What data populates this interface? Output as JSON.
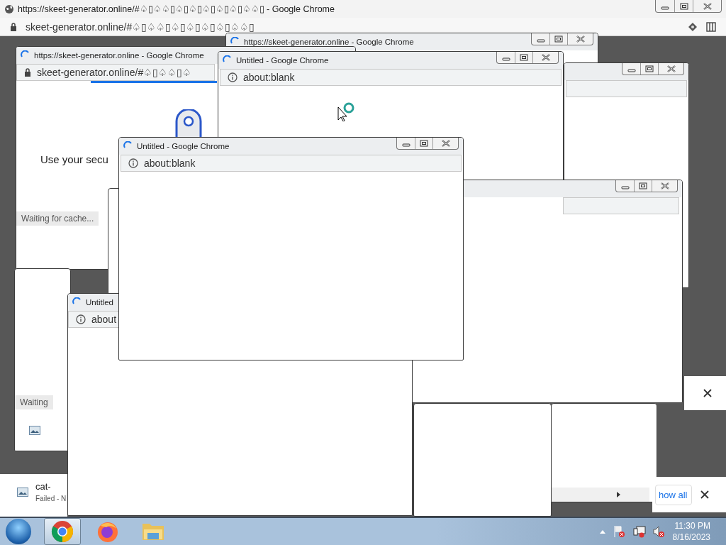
{
  "main_window": {
    "title": "https://skeet-generator.online/#♤▯♤♤▯♤▯♤▯♤▯♤▯♤▯♤♤▯ - Google Chrome",
    "loading": false,
    "url": "skeet-generator.online/#♤▯♤♤▯♤▯♤▯♤▯♤▯♤♤▯",
    "secure": true
  },
  "windows": [
    {
      "kind": "window",
      "title": "https://skeet-generator.online - Google Chrome",
      "loading": true
    },
    {
      "kind": "window"
    },
    {
      "kind": "window",
      "title": "https://skeet-generator.online - Google Chrome",
      "loading": true,
      "url": "skeet-generator.online/#♤▯♤♤▯♤",
      "secure": true,
      "text": "Use your secu",
      "status": "Waiting for cache..."
    },
    {
      "kind": "window",
      "title": "Untitled - Google Chrome",
      "loading": true,
      "url": "about:blank",
      "secure": false
    },
    {
      "kind": "fragment"
    },
    {
      "kind": "image-page",
      "status": "Waiting"
    },
    {
      "kind": "window"
    },
    {
      "kind": "window",
      "title": "Untitled",
      "loading": true,
      "url": "about",
      "secure": false
    },
    {
      "kind": "window",
      "title": "Untitled - Google Chrome",
      "loading": true,
      "url": "about:blank",
      "secure": false
    },
    {
      "kind": "fragment"
    },
    {
      "kind": "scroll-fragment"
    }
  ],
  "downloads": [
    {
      "name": "cat-",
      "status": "Failed - N"
    }
  ],
  "download_shelf": {
    "link": "how all"
  },
  "taskbar": {
    "apps": [
      {
        "kind": "chrome",
        "selected": true
      },
      {
        "kind": "firefox",
        "selected": false
      },
      {
        "kind": "explorer",
        "selected": false
      }
    ],
    "time": "11:30 PM",
    "date": "8/16/2023"
  }
}
